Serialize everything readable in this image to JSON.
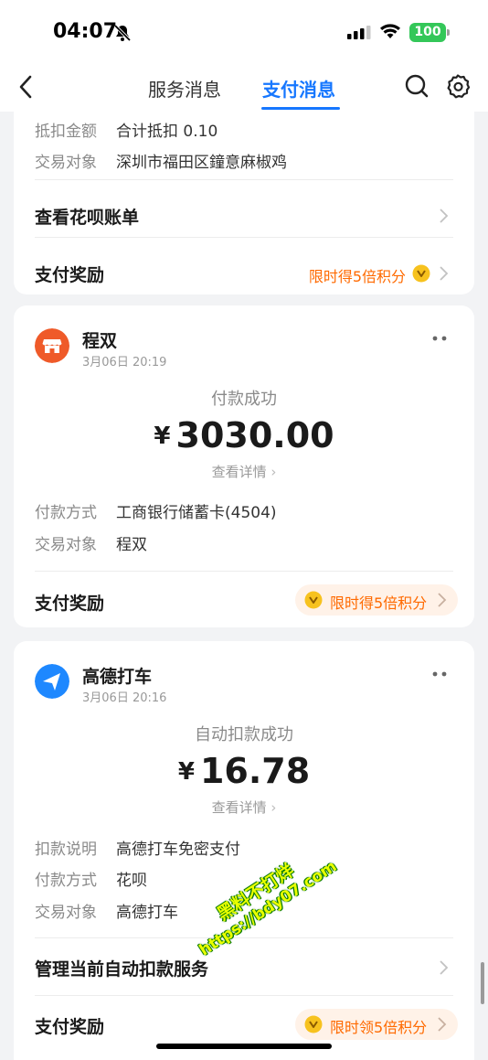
{
  "status_bar": {
    "time": "04:07",
    "battery": "100",
    "icons": [
      "bell-slash-icon",
      "signal-icon",
      "wifi-icon",
      "battery-icon"
    ]
  },
  "nav": {
    "tabs": [
      {
        "label": "服务消息",
        "active": false
      },
      {
        "label": "支付消息",
        "active": true
      }
    ],
    "icons": [
      "back-icon",
      "search-icon",
      "gear-icon"
    ],
    "accent_color": "#1677ff"
  },
  "card1": {
    "rows": [
      {
        "key": "抵扣金额",
        "value": "合计抵扣 0.10"
      },
      {
        "key": "交易对象",
        "value": "深圳市福田区鐘意麻椒鸡"
      }
    ],
    "view_bill_label": "查看花呗账单",
    "reward_label": "支付奖励",
    "reward_text": "限时得5倍积分"
  },
  "card2": {
    "merchant": "程双",
    "time": "3月06日 20:19",
    "status": "付款成功",
    "currency": "¥",
    "amount": "3030.00",
    "detail_link": "查看详情",
    "rows": [
      {
        "key": "付款方式",
        "value": "工商银行储蓄卡(4504)"
      },
      {
        "key": "交易对象",
        "value": "程双"
      }
    ],
    "reward_label": "支付奖励",
    "reward_text": "限时得5倍积分"
  },
  "card3": {
    "merchant": "高德打车",
    "time": "3月06日 20:16",
    "status": "自动扣款成功",
    "currency": "¥",
    "amount": "16.78",
    "detail_link": "查看详情",
    "rows": [
      {
        "key": "扣款说明",
        "value": "高德打车免密支付"
      },
      {
        "key": "付款方式",
        "value": "花呗"
      },
      {
        "key": "交易对象",
        "value": "高德打车"
      }
    ],
    "manage_label": "管理当前自动扣款服务",
    "reward_label": "支付奖励",
    "reward_text": "限时领5倍积分"
  },
  "watermark": {
    "line1": "黑料不打烊",
    "line2": "https://bdy07.com"
  },
  "colors": {
    "reward_orange": "#ff6a00",
    "shop_avatar": "#ef5a29",
    "amap_avatar": "#1e88ff"
  }
}
